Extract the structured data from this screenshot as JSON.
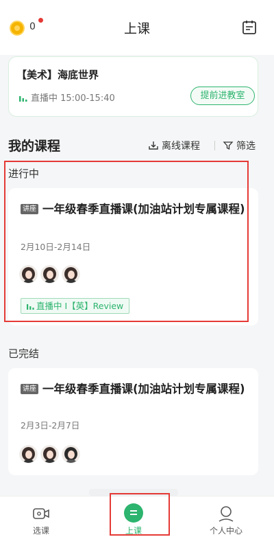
{
  "header": {
    "coin_count": "0",
    "title": "上课"
  },
  "live_now": {
    "title": "【美术】海底世界",
    "status": "直播中 15:00-15:40",
    "enter_label": "提前进教室"
  },
  "my_courses": {
    "title": "我的课程",
    "offline_label": "离线课程",
    "filter_label": "筛选"
  },
  "in_progress": {
    "label": "进行中",
    "course": {
      "tag": "讲座",
      "title": "一年级春季直播课(加油站计划专属课程)",
      "date": "2月10日-2月14日",
      "live_tag": "直播中 I【英】Review"
    }
  },
  "finished": {
    "label": "已完结",
    "course": {
      "tag": "讲座",
      "title": "一年级春季直播课(加油站计划专属课程)",
      "date": "2月3日-2月7日"
    }
  },
  "tabs": [
    {
      "label": "选课"
    },
    {
      "label": "上课"
    },
    {
      "label": "个人中心"
    }
  ],
  "colors": {
    "accent": "#2db46e",
    "highlight": "#e53935"
  }
}
